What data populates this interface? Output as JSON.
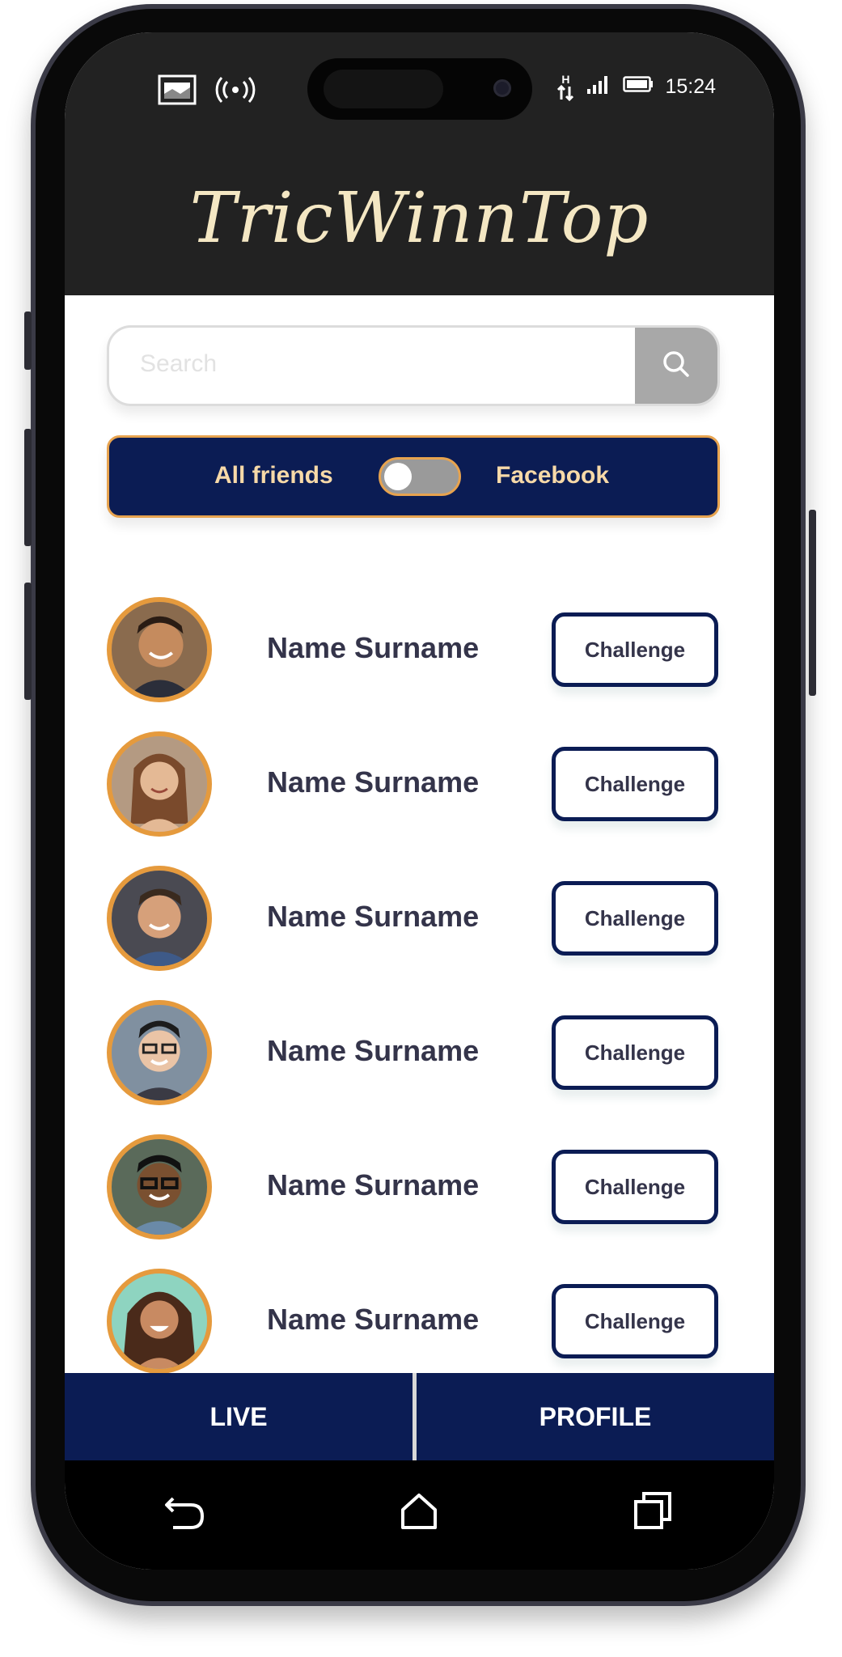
{
  "status_bar": {
    "time": "15:24",
    "network": "H"
  },
  "app": {
    "title": "TricWinnTop"
  },
  "search": {
    "placeholder": "Search"
  },
  "filter": {
    "left_label": "All friends",
    "right_label": "Facebook",
    "facebook_on": false
  },
  "friends": [
    {
      "name": "Name Surname",
      "action": "Challenge"
    },
    {
      "name": "Name Surname",
      "action": "Challenge"
    },
    {
      "name": "Name Surname",
      "action": "Challenge"
    },
    {
      "name": "Name Surname",
      "action": "Challenge"
    },
    {
      "name": "Name Surname",
      "action": "Challenge"
    },
    {
      "name": "Name Surname",
      "action": "Challenge"
    }
  ],
  "bottom_nav": {
    "live": "LIVE",
    "profile": "PROFILE"
  },
  "system_nav": {
    "icons": [
      "back-icon",
      "home-icon",
      "recents-icon"
    ]
  },
  "colors": {
    "navy": "#0b1c54",
    "orange": "#e59a3d",
    "cream": "#f4e7c3",
    "header": "#222222"
  }
}
